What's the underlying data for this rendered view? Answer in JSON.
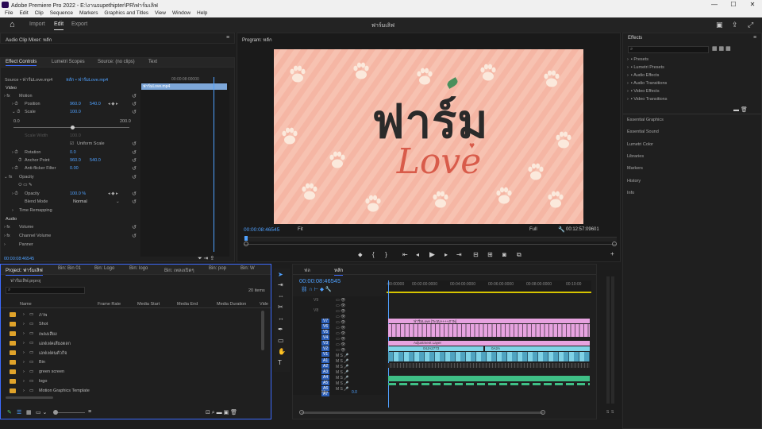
{
  "window": {
    "title": "Adobe Premiere Pro 2022 - E:\\งานsupethipter\\PR\\ฟาร์มเลิฟ",
    "minimize": "—",
    "maximize": "☐",
    "close": "✕"
  },
  "menu": [
    "File",
    "Edit",
    "Clip",
    "Sequence",
    "Markers",
    "Graphics and Titles",
    "View",
    "Window",
    "Help"
  ],
  "workspace": {
    "tabs": [
      "Import",
      "Edit",
      "Export"
    ],
    "active": "Edit",
    "center_title": "ฟาร์มเลิฟ"
  },
  "audio_mixer": {
    "title": "Audio Clip Mixer: หลัก"
  },
  "effect_controls": {
    "tabs": [
      "Effect Controls",
      "Lumetri Scopes",
      "Source: (no clips)",
      "Text"
    ],
    "source_label": "Source • ฟาร์มLove.mp4",
    "seq_label": "หลัก • ฟาร์มLove.mp4",
    "mini_timecode": "00:00:08:00000",
    "clip_name": "ฟาร์มLove.mp4",
    "video_label": "Video",
    "motion": "Motion",
    "position_label": "Position",
    "position_x": "960.0",
    "position_y": "540.0",
    "scale_label": "Scale",
    "scale_value": "100.0",
    "scale_min": "0.0",
    "scale_max": "200.0",
    "scale_width_label": "Scale Width",
    "scale_width_value": "100.0",
    "uniform_scale": "Uniform Scale",
    "rotation_label": "Rotation",
    "rotation_value": "0.0",
    "anchor_label": "Anchor Point",
    "anchor_x": "960.0",
    "anchor_y": "540.0",
    "antiflicker_label": "Anti-flicker Filter",
    "antiflicker_value": "0.00",
    "opacity_section": "Opacity",
    "opacity_label": "Opacity",
    "opacity_value": "100.0 %",
    "blend_label": "Blend Mode",
    "blend_value": "Normal",
    "time_remap": "Time Remapping",
    "audio_label": "Audio",
    "volume": "Volume",
    "channel_volume": "Channel Volume",
    "panner": "Panner",
    "timecode": "00:00:08:46545"
  },
  "program": {
    "title": "Program: หลัก",
    "timecode": "00:00:08:46545",
    "fit": "Fit",
    "quality": "Full",
    "duration": "00:12:57:09601",
    "artwork_title": "ฟาร์ม",
    "artwork_sub": "Love"
  },
  "right_panel": {
    "effects_title": "Effects",
    "effects_items": [
      "Presets",
      "Lumetri Presets",
      "Audio Effects",
      "Audio Transitions",
      "Video Effects",
      "Video Transitions"
    ],
    "sections": [
      "Essential Graphics",
      "Essential Sound",
      "Lumetri Color",
      "Libraries",
      "Markers",
      "History",
      "Info"
    ]
  },
  "project": {
    "tabs": [
      "Project: ฟาร์มเลิฟ",
      "Bin: Bin 01",
      "Bin: Logo",
      "Bin: logo",
      "Bin: เพลงเปิดๆ",
      "Bin: pop",
      "Bin: W"
    ],
    "project_file": "ฟาร์มเลิฟ.prproj",
    "item_count": "20 items",
    "columns": [
      "Name",
      "Frame Rate",
      "Media Start",
      "Media End",
      "Media Duration",
      "Vide"
    ],
    "rows": [
      "ภาพ",
      "Shot",
      "เพลงเสียง",
      "เอฟเฟคเสียงตลก",
      "เอฟเฟคนตัวกิจ",
      "Bin",
      "green screen",
      "logo",
      "Motion Graphics Template"
    ]
  },
  "timeline": {
    "sequence_tab": "หลัก",
    "other_tab": "ฟล",
    "timecode": "00:00:08:46545",
    "ruler": [
      ":00:00000",
      "00:02:00:0000",
      "00:04:00:0000",
      "00:06:00:0000",
      "00:08:00:0000",
      "00:10:00"
    ],
    "video_tracks": [
      "V9",
      "V8",
      "V7",
      "V6",
      "V5",
      "V4",
      "V3",
      "V2",
      "V1"
    ],
    "audio_tracks": [
      "A1",
      "A2",
      "A3",
      "A4",
      "A5",
      "A6",
      "A7"
    ],
    "mix_label": "Mix",
    "mix_value": "0.0",
    "clip_labels": [
      "ฟาร์มLove [ระบบ++++ภาพ]",
      "Adjustment Layer",
      "04JA2773",
      "0A2A"
    ],
    "meter_labels": [
      "S",
      "S"
    ]
  },
  "colors": {
    "accent_blue": "#4fa1ff",
    "clip_pink": "#e7a3e0",
    "clip_cyan": "#7fd2e6",
    "clip_green": "#3fbf86",
    "art_bg": "#f7c2b1",
    "art_text": "#2a2a2a",
    "art_love": "#d85b4a"
  }
}
